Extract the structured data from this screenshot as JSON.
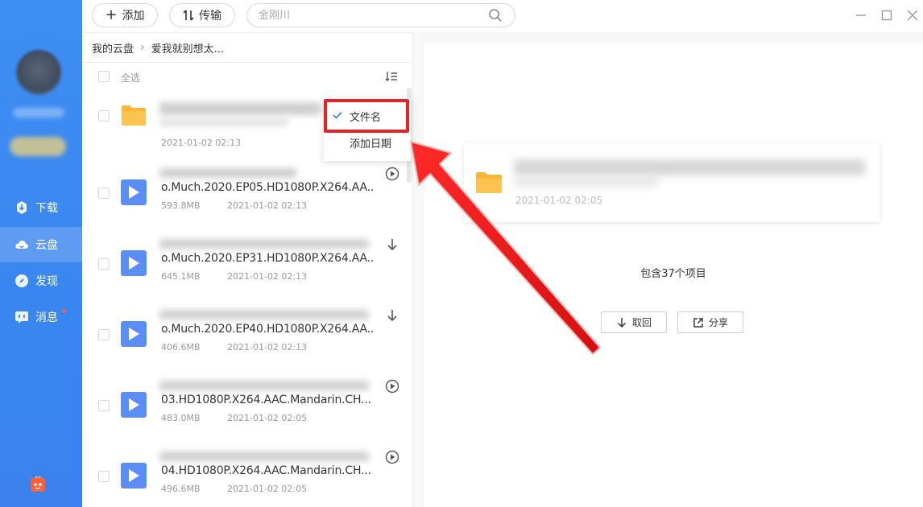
{
  "toolbar": {
    "add_label": "添加",
    "transfer_label": "传输",
    "search_placeholder": "金刚川"
  },
  "sidebar": {
    "items": [
      {
        "label": "下载",
        "icon": "download-icon"
      },
      {
        "label": "云盘",
        "icon": "cloud-icon"
      },
      {
        "label": "发现",
        "icon": "compass-icon"
      },
      {
        "label": "消息",
        "icon": "message-icon"
      }
    ],
    "active": "云盘",
    "accent": "#3b87f1"
  },
  "breadcrumb": {
    "root": "我的云盘",
    "current": "爱我就别想太..."
  },
  "list": {
    "select_all": "全选",
    "rows": [
      {
        "type": "folder",
        "name": "",
        "size": "",
        "date": "2021-01-02 02:13"
      },
      {
        "type": "video",
        "name": "o.Much.2020.EP05.HD1080P.X264.AA...",
        "size": "593.8MB",
        "date": "2021-01-02 02:13",
        "action": "play-icon"
      },
      {
        "type": "video",
        "name": "o.Much.2020.EP31.HD1080P.X264.AA...",
        "size": "645.1MB",
        "date": "2021-01-02 02:13",
        "action": "download-arrow-icon"
      },
      {
        "type": "video",
        "name": "o.Much.2020.EP40.HD1080P.X264.AA...",
        "size": "406.6MB",
        "date": "2021-01-02 02:13",
        "action": "download-arrow-icon"
      },
      {
        "type": "video",
        "name": "03.HD1080P.X264.AAC.Mandarin.CH...",
        "size": "483.0MB",
        "date": "2021-01-02 02:05",
        "action": "play-icon"
      },
      {
        "type": "video",
        "name": "04.HD1080P.X264.AAC.Mandarin.CH...",
        "size": "496.6MB",
        "date": "2021-01-02 02:05",
        "action": "play-icon"
      }
    ]
  },
  "sort_menu": {
    "options": [
      "文件名",
      "添加日期"
    ],
    "selected": "文件名"
  },
  "detail": {
    "date": "2021-01-02 02:05",
    "count": "包含37个项目",
    "retrieve_label": "取回",
    "share_label": "分享"
  }
}
